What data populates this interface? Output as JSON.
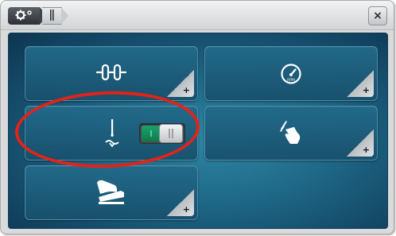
{
  "titlebar": {
    "home_icon": "gear-settings-icon",
    "current_icon": "presser-foot-icon",
    "close_label": "×"
  },
  "tiles": [
    {
      "id": "thread-tension",
      "icon": "thread-tension-icon",
      "corner_label": "+"
    },
    {
      "id": "speed",
      "icon": "speedometer-icon",
      "corner_label": "+"
    },
    {
      "id": "needle-stop",
      "icon": "needle-stop-icon",
      "toggle_state": "on",
      "toggle_on_label": "I"
    },
    {
      "id": "knee-lifter",
      "icon": "hand-gesture-icon",
      "corner_label": "+"
    },
    {
      "id": "foot-control",
      "icon": "foot-pedal-icon",
      "corner_label": "+"
    }
  ],
  "colors": {
    "accent_panel": "#1f6887",
    "toggle_on": "#18a36c",
    "annotation": "#e2231a"
  }
}
